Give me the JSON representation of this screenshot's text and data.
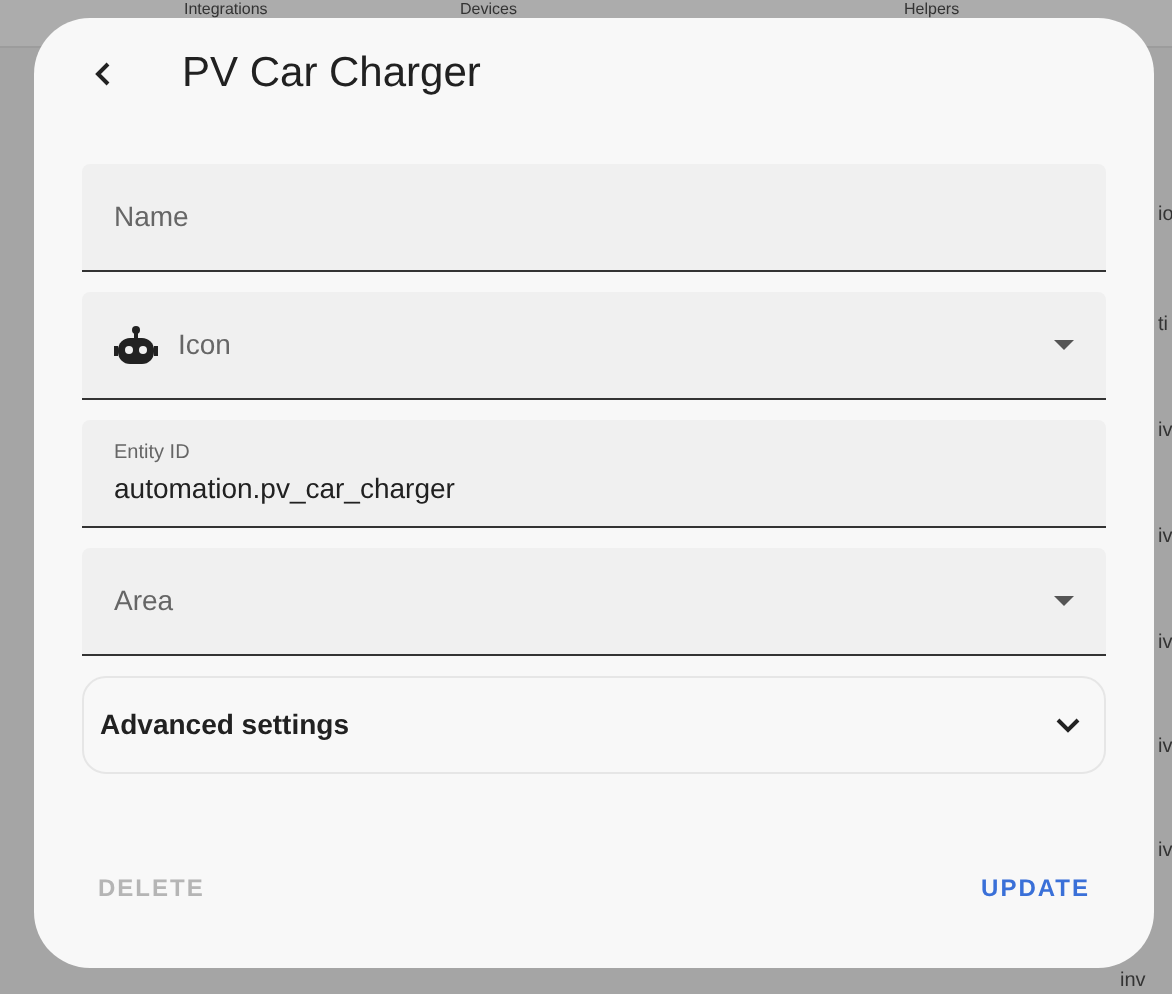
{
  "background": {
    "tabs": [
      "Integrations",
      "Devices",
      "Helpers"
    ],
    "row_fragments": [
      "io",
      "ti",
      "iv",
      "iv",
      "iv",
      "iv",
      "iv",
      "inv"
    ]
  },
  "dialog": {
    "title": "PV Car Charger",
    "fields": [
      {
        "kind": "text",
        "placeholder": "Name"
      },
      {
        "kind": "icon-select",
        "placeholder": "Icon"
      },
      {
        "kind": "text",
        "label": "Entity ID",
        "value": "automation.pv_car_charger"
      },
      {
        "kind": "select",
        "placeholder": "Area"
      }
    ],
    "advanced": {
      "label": "Advanced settings",
      "expanded": false
    },
    "buttons": [
      {
        "label": "DELETE",
        "disabled": true
      },
      {
        "label": "UPDATE",
        "disabled": false
      }
    ]
  }
}
